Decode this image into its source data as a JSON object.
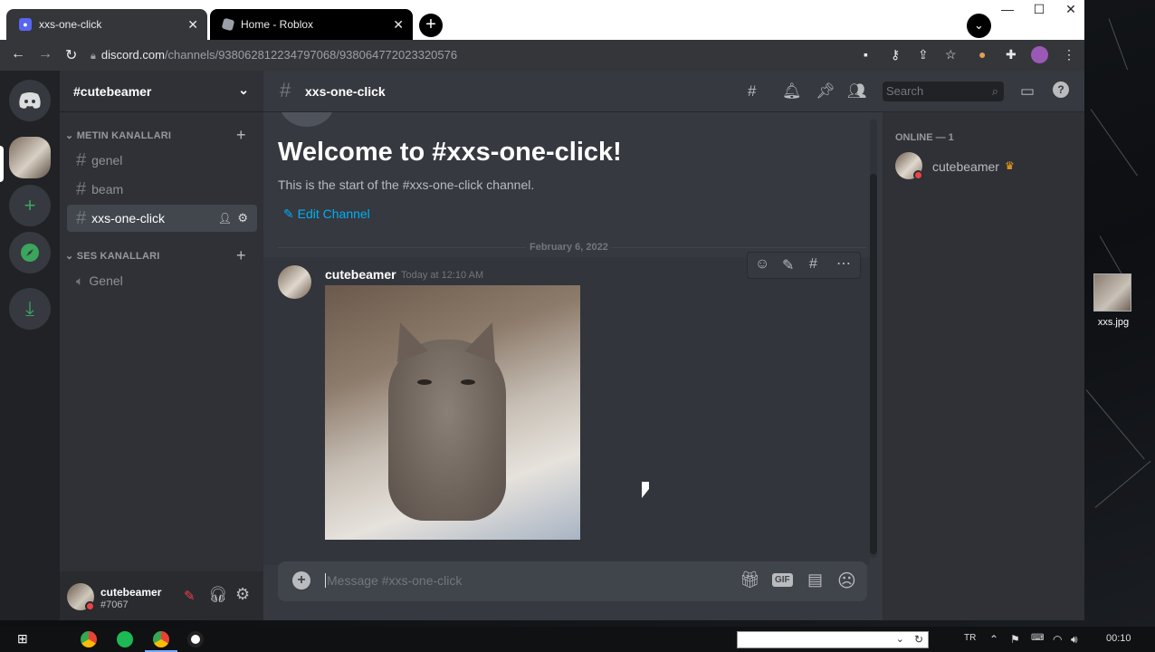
{
  "browser": {
    "tabs": [
      {
        "title": "xxs-one-click",
        "active": true
      },
      {
        "title": "Home - Roblox",
        "active": false
      }
    ],
    "url_host": "discord.com",
    "url_path": "/channels/938062812234797068/938064772023320576"
  },
  "discord": {
    "server_name": "#cutebeamer",
    "categories": [
      {
        "name": "METIN KANALLARI",
        "channels": [
          "genel",
          "beam",
          "xxs-one-click"
        ]
      },
      {
        "name": "SES KANALLARI",
        "channels": [
          "Genel"
        ]
      }
    ],
    "selected_channel": "xxs-one-click",
    "header_channel": "xxs-one-click",
    "search_placeholder": "Search",
    "welcome_title": "Welcome to #xxs-one-click!",
    "welcome_sub": "This is the start of the #xxs-one-click channel.",
    "edit_channel": "Edit Channel",
    "date_divider": "February 6, 2022",
    "message": {
      "author": "cutebeamer",
      "timestamp": "Today at 12:10 AM"
    },
    "composer_placeholder": "Message #xxs-one-click",
    "composer_gif": "GIF",
    "members_header": "ONLINE — 1",
    "member_name": "cutebeamer",
    "user": {
      "name": "cutebeamer",
      "tag": "#7067"
    }
  },
  "desktop": {
    "file_name": "xxs.jpg"
  },
  "taskbar": {
    "lang": "TR",
    "clock": "00:10"
  },
  "colors": {
    "blurple": "#5865f2",
    "green": "#3ba55d",
    "link": "#00aff4",
    "dnd": "#ed4245"
  }
}
